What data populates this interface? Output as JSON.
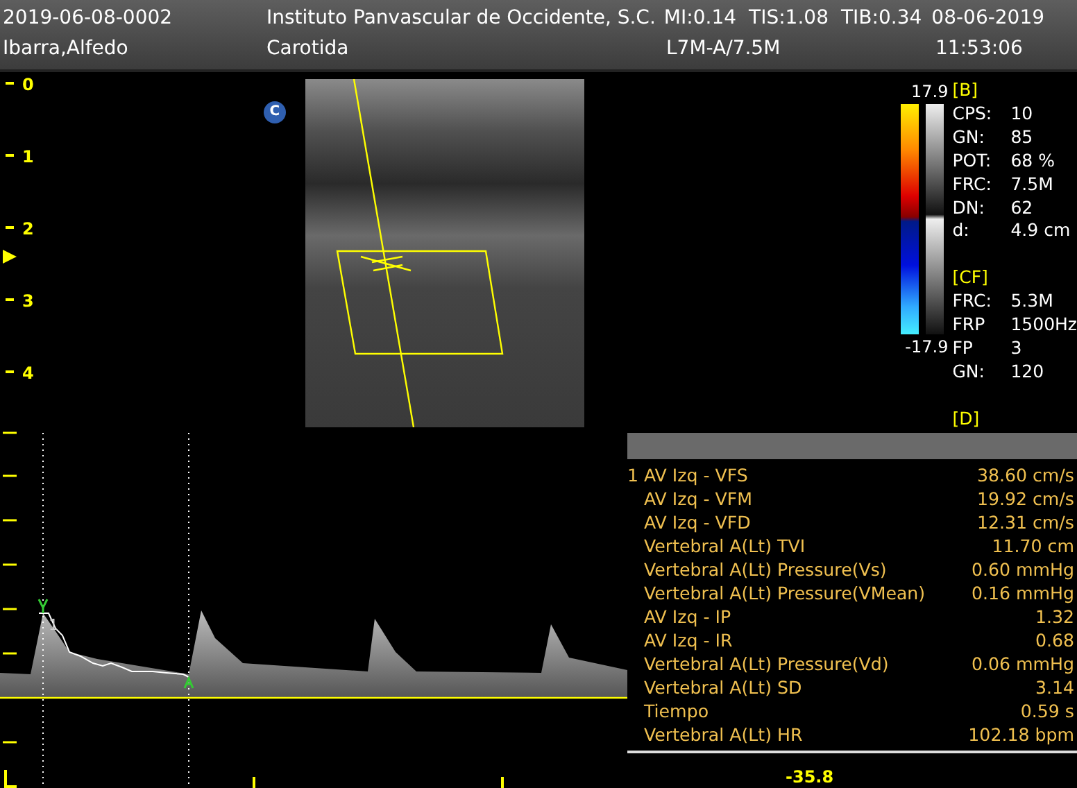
{
  "header": {
    "patient_id": "2019-06-08-0002",
    "institution": "Instituto Panvascular de Occidente, S.C.",
    "mi": "MI:0.14",
    "tis": "TIS:1.08",
    "tib": "TIB:0.34",
    "date": "08-06-2019",
    "patient_name": "Ibarra,Alfedo",
    "exam": "Carotida",
    "probe": "L7M-A/7.5M",
    "time": "11:53:06"
  },
  "depth_scale": [
    "0",
    "1",
    "2",
    "3",
    "4"
  ],
  "mode_badge": "C",
  "color_scale": {
    "max": "17.9",
    "min": "-17.9"
  },
  "parameters": [
    {
      "section": "[B]",
      "items": [
        {
          "label": "CPS:",
          "value": "10"
        },
        {
          "label": "GN:",
          "value": "85"
        },
        {
          "label": "POT:",
          "value": "68 %"
        },
        {
          "label": "FRC:",
          "value": "7.5M"
        },
        {
          "label": "DN:",
          "value": "62"
        },
        {
          "label": "d:",
          "value": "4.9 cm"
        }
      ]
    },
    {
      "section": "[CF]",
      "items": [
        {
          "label": "FRC:",
          "value": "5.3M"
        },
        {
          "label": "FRP",
          "value": "1500Hz"
        },
        {
          "label": "FP",
          "value": "3"
        },
        {
          "label": "GN:",
          "value": "120"
        }
      ]
    },
    {
      "section": "[D]"
    }
  ],
  "measurements": {
    "index": "1",
    "rows": [
      {
        "label": "AV Izq - VFS",
        "value": "38.60 cm/s"
      },
      {
        "label": "AV Izq - VFM",
        "value": "19.92 cm/s"
      },
      {
        "label": "AV Izq - VFD",
        "value": "12.31 cm/s"
      },
      {
        "label": "Vertebral A(Lt) TVI",
        "value": "11.70 cm"
      },
      {
        "label": "Vertebral A(Lt) Pressure(Vs)",
        "value": "0.60 mmHg"
      },
      {
        "label": "Vertebral A(Lt) Pressure(VMean)",
        "value": "0.16 mmHg"
      },
      {
        "label": "AV Izq - IP",
        "value": "1.32"
      },
      {
        "label": "AV Izq - IR",
        "value": "0.68"
      },
      {
        "label": "Vertebral A(Lt) Pressure(Vd)",
        "value": "0.06 mmHg"
      },
      {
        "label": "Vertebral A(Lt) SD",
        "value": "3.14"
      },
      {
        "label": "Tiempo",
        "value": "0.59 s"
      },
      {
        "label": "Vertebral A(Lt) HR",
        "value": "102.18 bpm"
      }
    ]
  },
  "spectrum": {
    "marker_label": "1",
    "baseline_reading": "-35.8"
  }
}
